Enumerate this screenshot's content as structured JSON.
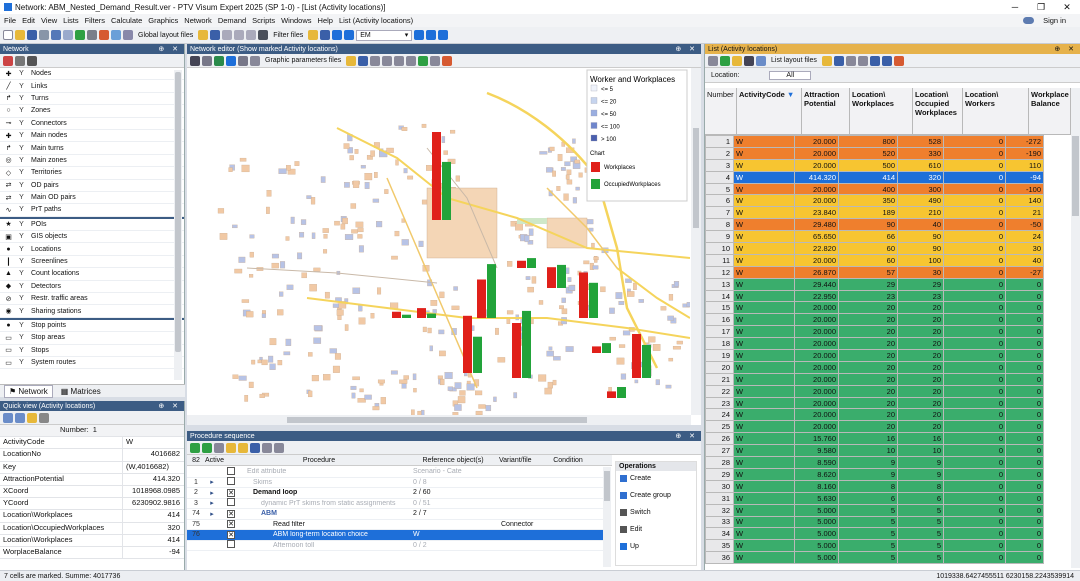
{
  "window": {
    "title": "Network: ABM_Nested_Demand_Result.ver - PTV Visum Expert 2025 (SP 1-0) - [List (Activity locations)]",
    "signin": "Sign in"
  },
  "menu": [
    "File",
    "Edit",
    "View",
    "Lists",
    "Filters",
    "Calculate",
    "Graphics",
    "Network",
    "Demand",
    "Scripts",
    "Windows",
    "Help",
    "List (Activity locations)"
  ],
  "toolbar": {
    "global_layout": "Global layout files",
    "filter_files": "Filter files",
    "em": "EM"
  },
  "network_panel": {
    "title": "Network",
    "items": [
      {
        "label": "Nodes",
        "icon": "✚"
      },
      {
        "label": "Links",
        "icon": "╱"
      },
      {
        "label": "Turns",
        "icon": "↱"
      },
      {
        "label": "Zones",
        "icon": "○"
      },
      {
        "label": "Connectors",
        "icon": "⊸"
      },
      {
        "label": "Main nodes",
        "icon": "✚"
      },
      {
        "label": "Main turns",
        "icon": "↱"
      },
      {
        "label": "Main zones",
        "icon": "◎"
      },
      {
        "label": "Territories",
        "icon": "◇"
      },
      {
        "label": "OD pairs",
        "icon": "⇄"
      },
      {
        "label": "Main OD pairs",
        "icon": "⇄"
      },
      {
        "label": "PrT paths",
        "icon": "∿"
      }
    ],
    "items2": [
      {
        "label": "POIs",
        "icon": "★"
      },
      {
        "label": "GIS objects",
        "icon": "▣"
      },
      {
        "label": "Locations",
        "icon": "●"
      },
      {
        "label": "Screenlines",
        "icon": "┃"
      },
      {
        "label": "Count locations",
        "icon": "▲"
      },
      {
        "label": "Detectors",
        "icon": "◆"
      },
      {
        "label": "Restr. traffic areas",
        "icon": "⊘"
      },
      {
        "label": "Sharing stations",
        "icon": "◉"
      }
    ],
    "items3": [
      {
        "label": "Stop points",
        "icon": "●"
      },
      {
        "label": "Stop areas",
        "icon": "▭"
      },
      {
        "label": "Stops",
        "icon": "▭"
      },
      {
        "label": "System routes",
        "icon": "▭"
      }
    ],
    "tabs": [
      "Network",
      "Matrices"
    ]
  },
  "quick_view": {
    "title": "Quick view (Activity locations)",
    "header_label": "Number:",
    "header_value": "1",
    "rows": [
      {
        "k": "ActivityCode",
        "v": "W",
        "left": true
      },
      {
        "k": "LocationNo",
        "v": "4016682"
      },
      {
        "k": "Key",
        "v": "(W,4016682)",
        "left": true
      },
      {
        "k": "AttractionPotential",
        "v": "414.320"
      },
      {
        "k": "XCoord",
        "v": "1018968.0985"
      },
      {
        "k": "YCoord",
        "v": "6230902.9816"
      },
      {
        "k": "Location\\Workplaces",
        "v": "414"
      },
      {
        "k": "Location\\OccupiedWorkplaces",
        "v": "320"
      },
      {
        "k": "Location\\Workplaces",
        "v": "414"
      },
      {
        "k": "WorplaceBalance",
        "v": "-94"
      }
    ]
  },
  "network_editor": {
    "title": "Network editor (Show marked Activity locations)",
    "graphic_params": "Graphic parameters files",
    "legend_title": "Worker and Workplaces",
    "legend_items": [
      "<= 5",
      "<= 20",
      "<= 50",
      "<= 100",
      "> 100"
    ],
    "legend_colors": [
      "#eef2fa",
      "#c6d4ee",
      "#9aaee0",
      "#6f86cc",
      "#4b5fae"
    ],
    "chart_label": "Chart",
    "chart_items": [
      "Workplaces",
      "OccupiedWorkplaces"
    ],
    "chart_colors": [
      "#e0201a",
      "#22a33a"
    ]
  },
  "procedure": {
    "title": "Procedure sequence",
    "cols": [
      "Active",
      "Procedure",
      "Reference object(s)",
      "Variant/file",
      "Condition"
    ],
    "rows": [
      {
        "no": "",
        "active": "",
        "proc": "Edit attribute",
        "ref": "Scenario - Cate",
        "dim": true
      },
      {
        "no": "1",
        "active": "",
        "proc": "Skims",
        "ref": "0 / 8",
        "dim": true
      },
      {
        "no": "2",
        "active": "x",
        "proc": "Demand loop",
        "ref": "2 / 60",
        "bold": true
      },
      {
        "no": "3",
        "active": "",
        "proc": "dynamic PrT skims from static assignments",
        "ref": "0 / 51",
        "dim": true
      },
      {
        "no": "74",
        "active": "x",
        "proc": "ABM",
        "ref": "2 / 7",
        "blue": true
      },
      {
        "no": "75",
        "active": "x",
        "proc": "Read filter",
        "ref": "",
        "variant": "Connector"
      },
      {
        "no": "76",
        "active": "x",
        "proc": "ABM long-term location choice",
        "ref": "W",
        "sel": true
      },
      {
        "no": "",
        "active": "",
        "proc": "Afternoon toll",
        "ref": "0 / 2",
        "dim": true
      }
    ],
    "operations_title": "Operations",
    "ops": [
      "Create",
      "Create group",
      "Switch",
      "Edit",
      "Up"
    ]
  },
  "list": {
    "title": "List (Activity locations)",
    "location_label": "Location:",
    "location_value": "All",
    "layout_files": "List layout files",
    "headers": [
      "Number",
      "ActivityCode",
      "Attraction Potential",
      "Location\\ Workplaces",
      "Location\\ Occupied Workplaces",
      "Location\\ Workers",
      "Workplace Balance"
    ],
    "colors": {
      "orange": "#ef7f2d",
      "yellow": "#f7c531",
      "blue": "#1e6fd9",
      "green": "#3aad6c"
    },
    "rows": [
      [
        "1",
        "W",
        "20.000",
        "800",
        "528",
        "0",
        "-272",
        "orange"
      ],
      [
        "2",
        "W",
        "20.000",
        "520",
        "330",
        "0",
        "-190",
        "orange"
      ],
      [
        "3",
        "W",
        "20.000",
        "500",
        "610",
        "0",
        "110",
        "yellow"
      ],
      [
        "4",
        "W",
        "414.320",
        "414",
        "320",
        "0",
        "-94",
        "blue"
      ],
      [
        "5",
        "W",
        "20.000",
        "400",
        "300",
        "0",
        "-100",
        "orange"
      ],
      [
        "6",
        "W",
        "20.000",
        "350",
        "490",
        "0",
        "140",
        "yellow"
      ],
      [
        "7",
        "W",
        "23.840",
        "189",
        "210",
        "0",
        "21",
        "yellow"
      ],
      [
        "8",
        "W",
        "29.480",
        "90",
        "40",
        "0",
        "-50",
        "orange"
      ],
      [
        "9",
        "W",
        "65.650",
        "66",
        "90",
        "0",
        "24",
        "yellow"
      ],
      [
        "10",
        "W",
        "22.820",
        "60",
        "90",
        "0",
        "30",
        "yellow"
      ],
      [
        "11",
        "W",
        "20.000",
        "60",
        "100",
        "0",
        "40",
        "yellow"
      ],
      [
        "12",
        "W",
        "26.870",
        "57",
        "30",
        "0",
        "-27",
        "orange"
      ],
      [
        "13",
        "W",
        "29.440",
        "29",
        "29",
        "0",
        "0",
        "green"
      ],
      [
        "14",
        "W",
        "22.950",
        "23",
        "23",
        "0",
        "0",
        "green"
      ],
      [
        "15",
        "W",
        "20.000",
        "20",
        "20",
        "0",
        "0",
        "green"
      ],
      [
        "16",
        "W",
        "20.000",
        "20",
        "20",
        "0",
        "0",
        "green"
      ],
      [
        "17",
        "W",
        "20.000",
        "20",
        "20",
        "0",
        "0",
        "green"
      ],
      [
        "18",
        "W",
        "20.000",
        "20",
        "20",
        "0",
        "0",
        "green"
      ],
      [
        "19",
        "W",
        "20.000",
        "20",
        "20",
        "0",
        "0",
        "green"
      ],
      [
        "20",
        "W",
        "20.000",
        "20",
        "20",
        "0",
        "0",
        "green"
      ],
      [
        "21",
        "W",
        "20.000",
        "20",
        "20",
        "0",
        "0",
        "green"
      ],
      [
        "22",
        "W",
        "20.000",
        "20",
        "20",
        "0",
        "0",
        "green"
      ],
      [
        "23",
        "W",
        "20.000",
        "20",
        "20",
        "0",
        "0",
        "green"
      ],
      [
        "24",
        "W",
        "20.000",
        "20",
        "20",
        "0",
        "0",
        "green"
      ],
      [
        "25",
        "W",
        "20.000",
        "20",
        "20",
        "0",
        "0",
        "green"
      ],
      [
        "26",
        "W",
        "15.760",
        "16",
        "16",
        "0",
        "0",
        "green"
      ],
      [
        "27",
        "W",
        "9.580",
        "10",
        "10",
        "0",
        "0",
        "green"
      ],
      [
        "28",
        "W",
        "8.590",
        "9",
        "9",
        "0",
        "0",
        "green"
      ],
      [
        "29",
        "W",
        "8.620",
        "9",
        "9",
        "0",
        "0",
        "green"
      ],
      [
        "30",
        "W",
        "8.160",
        "8",
        "8",
        "0",
        "0",
        "green"
      ],
      [
        "31",
        "W",
        "5.630",
        "6",
        "6",
        "0",
        "0",
        "green"
      ],
      [
        "32",
        "W",
        "5.000",
        "5",
        "5",
        "0",
        "0",
        "green"
      ],
      [
        "33",
        "W",
        "5.000",
        "5",
        "5",
        "0",
        "0",
        "green"
      ],
      [
        "34",
        "W",
        "5.000",
        "5",
        "5",
        "0",
        "0",
        "green"
      ],
      [
        "35",
        "W",
        "5.000",
        "5",
        "5",
        "0",
        "0",
        "green"
      ],
      [
        "36",
        "W",
        "5.000",
        "5",
        "5",
        "0",
        "0",
        "green"
      ]
    ]
  },
  "status": {
    "left": "7 cells are marked. Summe: 4017736",
    "right": "1019338.6427455511 6230158.2243539914"
  }
}
